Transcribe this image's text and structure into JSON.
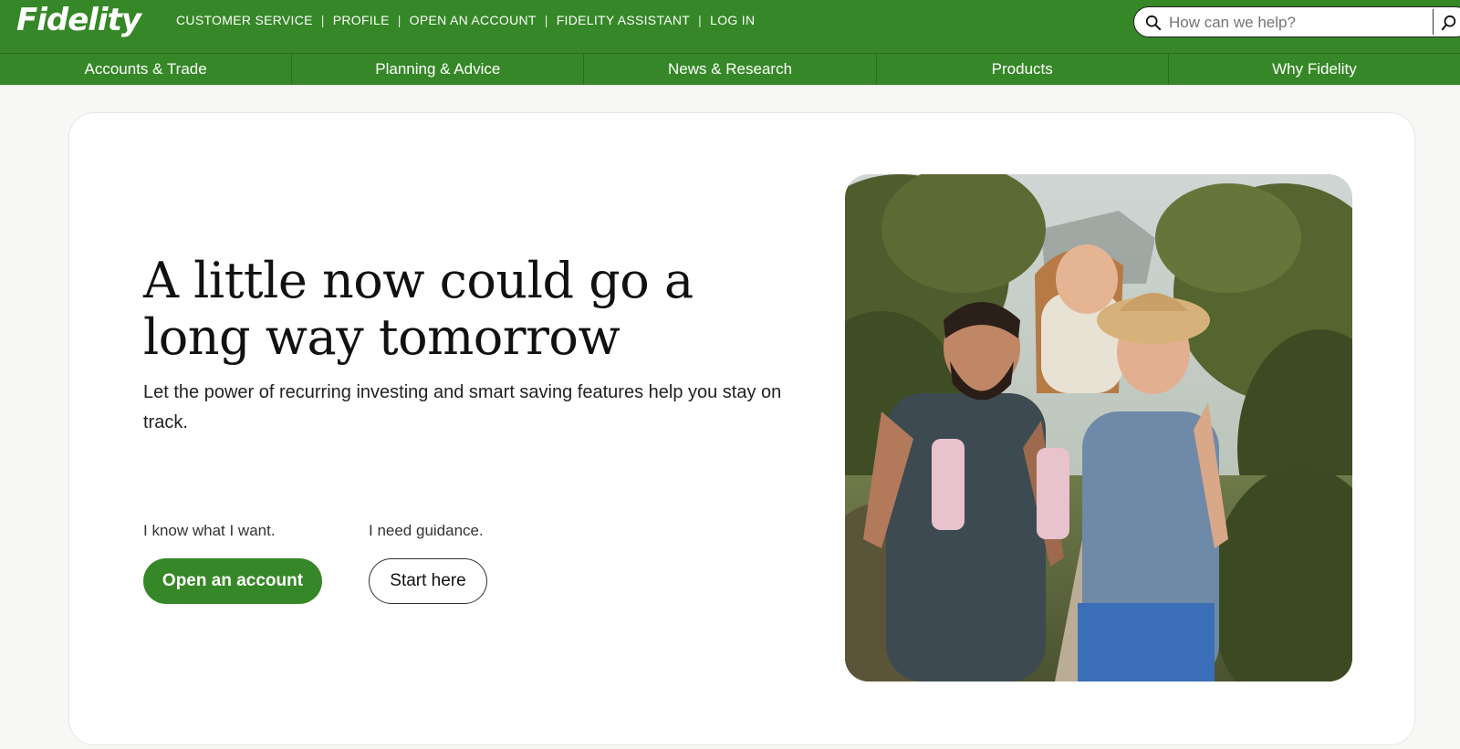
{
  "brand": {
    "logo_text": "Fidelity",
    "color": "#368727"
  },
  "utility_nav": [
    {
      "label": "CUSTOMER SERVICE"
    },
    {
      "label": "PROFILE"
    },
    {
      "label": "OPEN AN ACCOUNT"
    },
    {
      "label": "FIDELITY ASSISTANT"
    },
    {
      "label": "LOG IN"
    }
  ],
  "search": {
    "placeholder": "How can we help?",
    "icon": "search-icon",
    "submit_icon": "search-submit-icon"
  },
  "main_nav": [
    {
      "label": "Accounts & Trade"
    },
    {
      "label": "Planning & Advice"
    },
    {
      "label": "News & Research"
    },
    {
      "label": "Products"
    },
    {
      "label": "Why Fidelity"
    }
  ],
  "hero": {
    "headline": "A little now could go a long way tomorrow",
    "subtext": "Let the power of recurring investing and smart saving features help you stay on track.",
    "cta_primary": {
      "prompt": "I know what I want.",
      "label": "Open an account"
    },
    "cta_secondary": {
      "prompt": "I need guidance.",
      "label": "Start here"
    },
    "image": "family-photo"
  }
}
